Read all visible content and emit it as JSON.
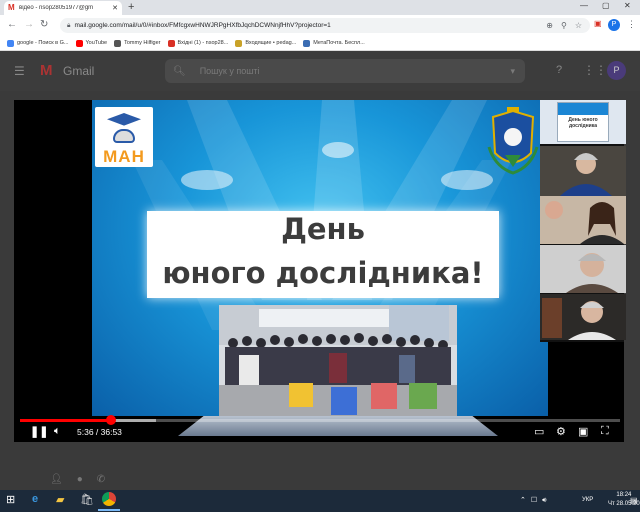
{
  "browser": {
    "tab_title": "відео - nsop28051977@gm",
    "url": "mail.google.com/mail/u/0/#inbox/FMfcgxwHNWJRPgHXfbJqchDCWNnjfHhV?projector=1",
    "profile_initial": "P"
  },
  "bookmarks": [
    {
      "label": "google - Поиск в G...",
      "color": "#4285f4"
    },
    {
      "label": "YouTube",
      "color": "#ff0000"
    },
    {
      "label": "Tommy Hilfiger",
      "color": "#555555"
    },
    {
      "label": "Вхідні (1) - nsop28...",
      "color": "#d93025"
    },
    {
      "label": "Входящие • pedag...",
      "color": "#c9a227"
    },
    {
      "label": "МетаПочта. Беспл...",
      "color": "#3b6db3"
    }
  ],
  "gmail": {
    "logo": "M",
    "wordmark": "Gmail",
    "search_placeholder": "Пошук у пошті",
    "avatar_initial": "P"
  },
  "slide": {
    "logo_text": "МАН",
    "title_line1": "День",
    "title_line2": "юного дослідника!"
  },
  "participants": [
    {
      "kind": "logo",
      "label": "День юного дослідника"
    },
    {
      "kind": "person",
      "hair": "#c9c9c9"
    },
    {
      "kind": "pair",
      "hair": "#3a2418"
    },
    {
      "kind": "person",
      "hair": "#b8b8b8"
    },
    {
      "kind": "person",
      "hair": "#d0d0d0"
    }
  ],
  "player": {
    "time": "5:36 / 36:53",
    "progress": 0.152,
    "buffered": 0.226
  },
  "taskbar": {
    "lang": "УКР",
    "time": "18:24",
    "date": "Чт 28.05.20"
  },
  "colors": {
    "accent_red": "#ff0000",
    "slide_blue": "#1895d8",
    "title_text": "#3c3c3c",
    "logo_orange": "#f39a1e"
  }
}
